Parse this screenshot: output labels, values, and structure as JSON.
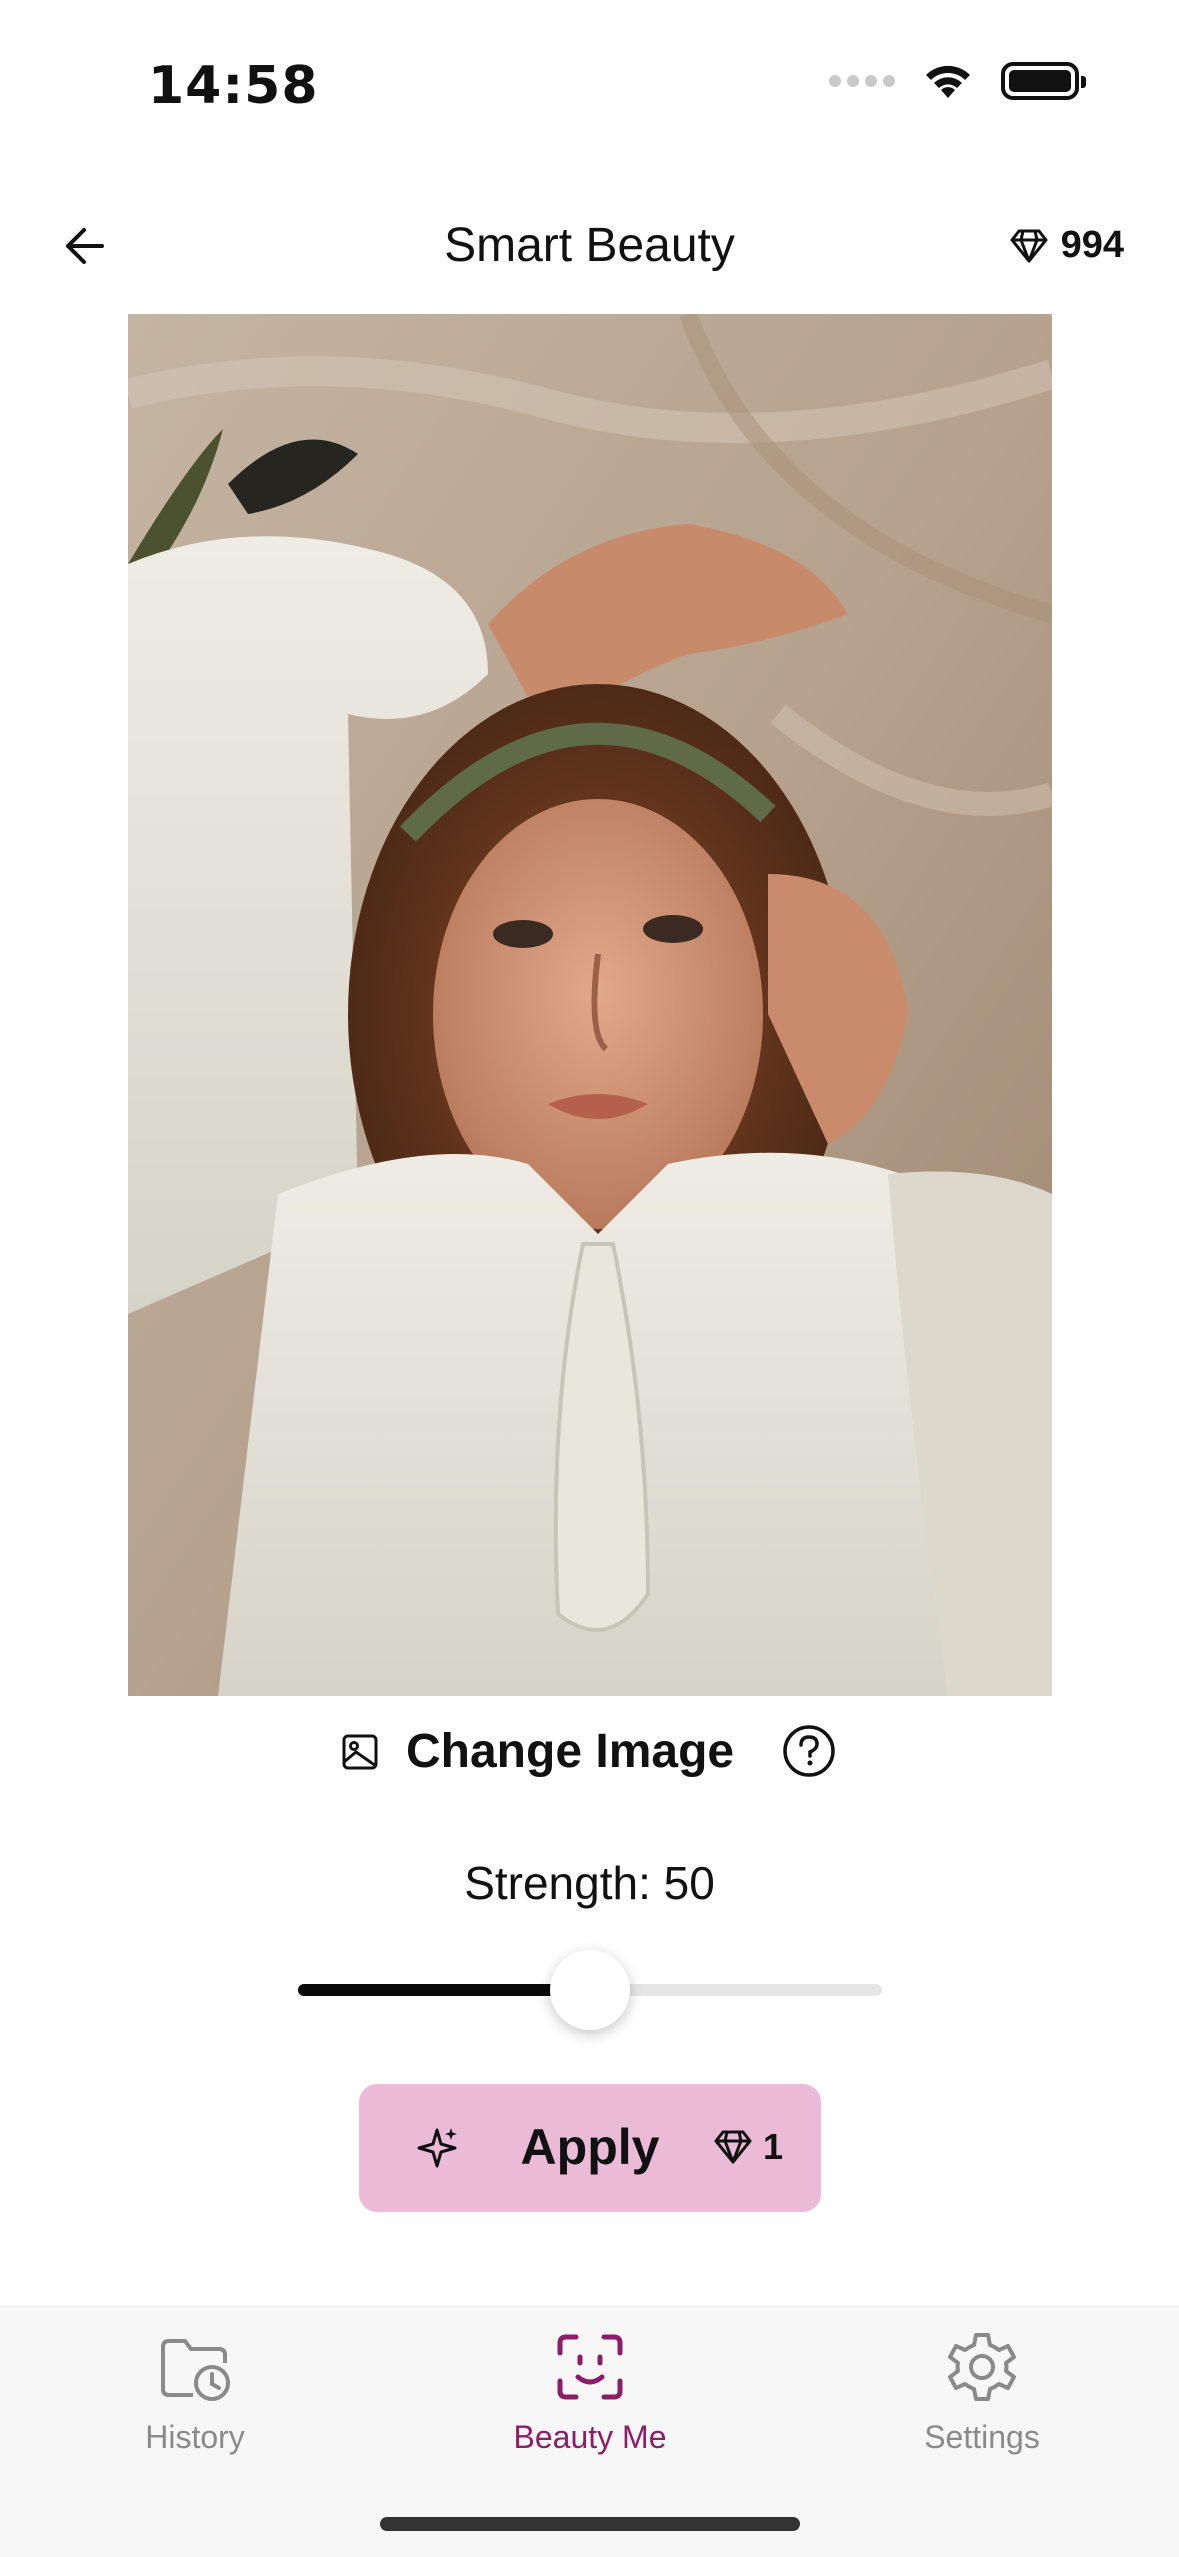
{
  "status_bar": {
    "time": "14:58",
    "icons": [
      "cellular-signal-icon",
      "wifi-icon",
      "battery-icon"
    ]
  },
  "header": {
    "back_icon": "arrow-left-icon",
    "title": "Smart Beauty",
    "credits_icon": "diamond-icon",
    "credits_value": "994"
  },
  "photo": {
    "description_icon": "photo-preview"
  },
  "change_image": {
    "icon": "image-icon",
    "label": "Change Image",
    "help_icon": "question-circle-icon"
  },
  "strength": {
    "label": "Strength: 50",
    "value": 50,
    "min": 0,
    "max": 100
  },
  "apply": {
    "icon": "sparkle-icon",
    "label": "Apply",
    "cost_icon": "diamond-icon",
    "cost": "1"
  },
  "bottom_nav": {
    "items": [
      {
        "label": "History",
        "icon": "folder-clock-icon",
        "active": false
      },
      {
        "label": "Beauty Me",
        "icon": "face-scan-icon",
        "active": true
      },
      {
        "label": "Settings",
        "icon": "gear-icon",
        "active": false
      }
    ]
  },
  "colors": {
    "accent": "#8c1d68",
    "apply_bg": "#ebbad6",
    "nav_bg": "#f7f7f7",
    "inactive": "#8a8a8a"
  }
}
